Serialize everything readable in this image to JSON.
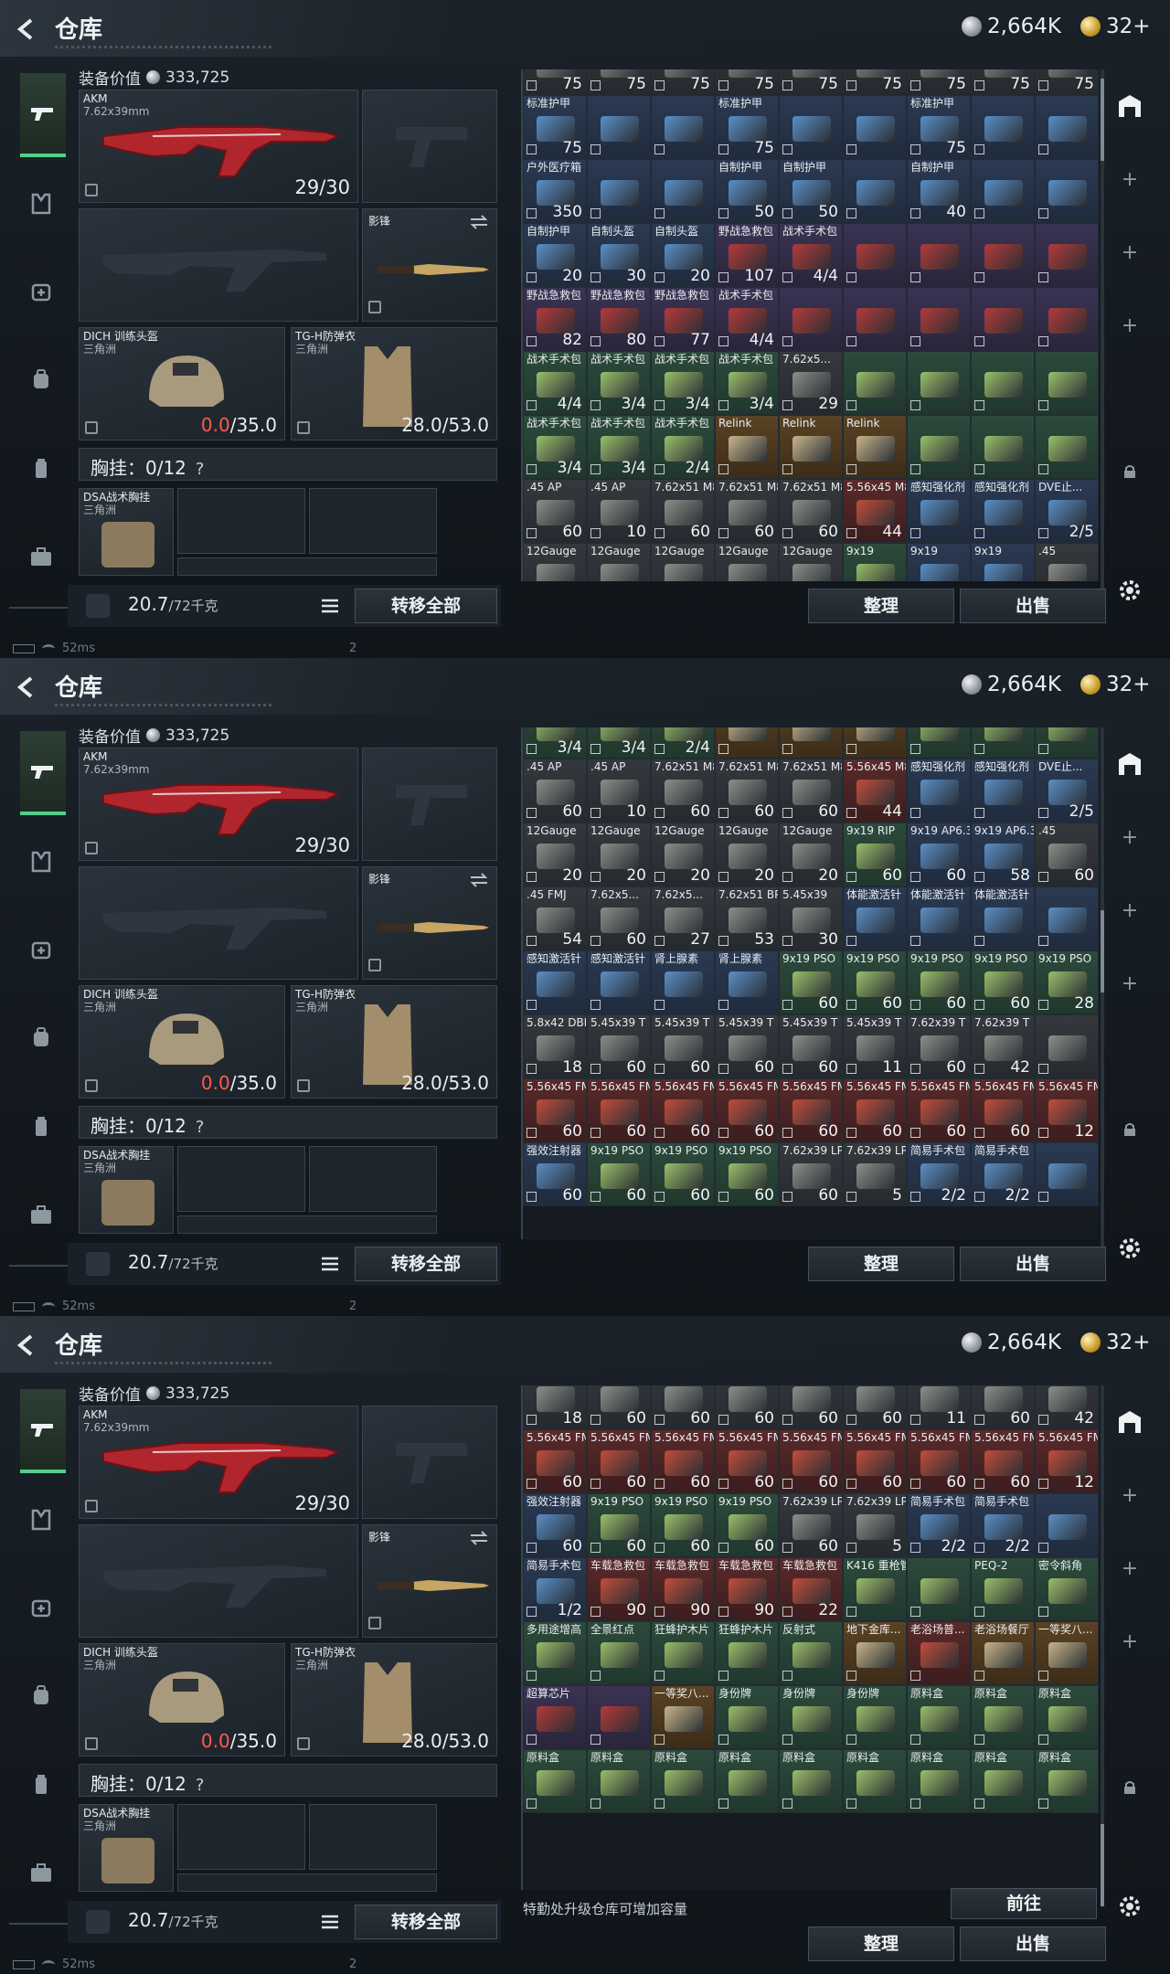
{
  "app": {
    "title": "仓库",
    "currency_silver": "2,664K",
    "currency_gold": "32+"
  },
  "loadout": {
    "value_label": "装备价值",
    "value": "333,725",
    "primary": {
      "name": "AKM",
      "caliber": "7.62x39mm",
      "ammo": "29/30"
    },
    "melee": {
      "name": "影锋"
    },
    "helmet": {
      "name": "DICH 训练头盔",
      "origin": "三角洲",
      "durability_cur": "0.0",
      "durability_max": "/35.0"
    },
    "armor": {
      "name": "TG-H防弹衣",
      "origin": "三角洲",
      "durability": "28.0/53.0"
    },
    "rig": {
      "label": "胸挂：0/12",
      "help": "?"
    },
    "rig_item": {
      "name": "DSA战术胸挂",
      "origin": "三角洲"
    },
    "weight": "20.7",
    "weight_max": "/72千克",
    "transfer_all": "转移全部"
  },
  "actions": {
    "sort": "整理",
    "sell": "出售",
    "goto": "前往",
    "upgrade_hint": "特勤处升级仓库可增加容量"
  },
  "status": {
    "ping": "52ms",
    "num": "2"
  },
  "panel1_rows": [
    [
      [
        "",
        "75",
        "gray"
      ],
      [
        "",
        "75",
        "gray"
      ],
      [
        "",
        "75",
        "gray"
      ],
      [
        "",
        "75",
        "gray"
      ],
      [
        "",
        "75",
        "gray"
      ],
      [
        "",
        "75",
        "gray"
      ],
      [
        "",
        "75",
        "gray"
      ],
      [
        "",
        "75",
        "gray"
      ],
      [
        "",
        "75",
        "gray"
      ]
    ],
    [
      [
        "标准护甲",
        "75",
        "blue"
      ],
      [
        "",
        "",
        "blue"
      ],
      [
        "",
        "",
        "blue"
      ],
      [
        "标准护甲",
        "75",
        "blue"
      ],
      [
        "",
        "",
        "blue"
      ],
      [
        "",
        "",
        "blue"
      ],
      [
        "标准护甲",
        "75",
        "blue"
      ],
      [
        "",
        "",
        "blue"
      ],
      [
        "",
        "",
        "blue"
      ]
    ],
    [
      [
        "户外医疗箱",
        "350",
        "blue"
      ],
      [
        "",
        "",
        "blue"
      ],
      [
        "",
        "",
        "blue"
      ],
      [
        "自制护甲",
        "50",
        "blue"
      ],
      [
        "自制护甲",
        "50",
        "blue"
      ],
      [
        "",
        "",
        "blue"
      ],
      [
        "自制护甲",
        "40",
        "blue"
      ],
      [
        "",
        "",
        "blue"
      ],
      [
        "",
        "",
        " blue"
      ]
    ],
    [
      [
        "自制护甲",
        "20",
        "blue"
      ],
      [
        "自制头盔",
        "30",
        "blue"
      ],
      [
        "自制头盔",
        "20",
        "blue"
      ],
      [
        "野战急救包",
        "107",
        "purple"
      ],
      [
        "战术手术包",
        "4/4",
        "purple"
      ],
      [
        "",
        "",
        "purple"
      ],
      [
        "",
        "",
        "purple"
      ],
      [
        "",
        "",
        "purple"
      ],
      [
        "",
        "",
        "purple"
      ]
    ],
    [
      [
        "野战急救包",
        "82",
        "purple"
      ],
      [
        "野战急救包",
        "80",
        "purple"
      ],
      [
        "野战急救包",
        "77",
        "purple"
      ],
      [
        "战术手术包",
        "4/4",
        "purple"
      ],
      [
        "",
        "",
        "purple"
      ],
      [
        "",
        "",
        "purple"
      ],
      [
        "",
        "",
        "purple"
      ],
      [
        "",
        "",
        "purple"
      ],
      [
        "",
        "",
        "purple"
      ]
    ],
    [
      [
        "战术手术包",
        "4/4",
        "green"
      ],
      [
        "战术手术包",
        "3/4",
        "green"
      ],
      [
        "战术手术包",
        "3/4",
        "green"
      ],
      [
        "战术手术包",
        "3/4",
        "green"
      ],
      [
        "7.62x5...",
        "29",
        "gray"
      ],
      [
        "",
        "",
        "green"
      ],
      [
        "",
        "",
        "green"
      ],
      [
        "",
        "",
        "green"
      ],
      [
        "",
        "",
        "green"
      ]
    ],
    [
      [
        "战术手术包",
        "3/4",
        "green"
      ],
      [
        "战术手术包",
        "3/4",
        "green"
      ],
      [
        "战术手术包",
        "2/4",
        "green"
      ],
      [
        "Relink",
        "",
        "gold"
      ],
      [
        "Relink",
        "",
        "gold"
      ],
      [
        "Relink",
        "",
        "gold"
      ],
      [
        "",
        "",
        "green"
      ],
      [
        "",
        "",
        "green"
      ],
      [
        "",
        "",
        "green"
      ]
    ],
    [
      [
        ".45 AP",
        "60",
        "gray"
      ],
      [
        ".45 AP",
        "10",
        "gray"
      ],
      [
        "7.62x51 M80",
        "60",
        "gray"
      ],
      [
        "7.62x51 M80",
        "60",
        "gray"
      ],
      [
        "7.62x51 M80",
        "60",
        "gray"
      ],
      [
        "5.56x45 M855A1",
        "44",
        "red"
      ],
      [
        "感知强化剂",
        "",
        "blue"
      ],
      [
        "感知强化剂",
        "",
        "blue"
      ],
      [
        "DVE止...",
        "2/5",
        "blue"
      ]
    ],
    [
      [
        "12Gauge",
        "",
        "gray"
      ],
      [
        "12Gauge",
        "",
        "gray"
      ],
      [
        "12Gauge",
        "",
        "gray"
      ],
      [
        "12Gauge",
        "",
        "gray"
      ],
      [
        "12Gauge",
        "",
        "gray"
      ],
      [
        "9x19",
        "",
        "green"
      ],
      [
        "9x19",
        "",
        "blue"
      ],
      [
        "9x19",
        "",
        "blue"
      ],
      [
        ".45",
        "",
        "gray"
      ]
    ]
  ],
  "panel2_rows": [
    [
      [
        "",
        "3/4",
        "green"
      ],
      [
        "",
        "3/4",
        "green"
      ],
      [
        "",
        "2/4",
        "green"
      ],
      [
        "",
        "",
        "gold"
      ],
      [
        "",
        "",
        "gold"
      ],
      [
        "",
        "",
        "gold"
      ],
      [
        "",
        "",
        "green"
      ],
      [
        "",
        "",
        "green"
      ],
      [
        "",
        "",
        "green"
      ]
    ],
    [
      [
        ".45 AP",
        "60",
        "gray"
      ],
      [
        ".45 AP",
        "10",
        "gray"
      ],
      [
        "7.62x51 M80",
        "60",
        "gray"
      ],
      [
        "7.62x51 M80",
        "60",
        "gray"
      ],
      [
        "7.62x51 M80",
        "60",
        "gray"
      ],
      [
        "5.56x45 M855A1",
        "44",
        "red"
      ],
      [
        "感知强化剂",
        "",
        "blue"
      ],
      [
        "感知强化剂",
        "",
        "blue"
      ],
      [
        "DVE止...",
        "2/5",
        "blue"
      ]
    ],
    [
      [
        "12Gauge",
        "20",
        "gray"
      ],
      [
        "12Gauge",
        "20",
        "gray"
      ],
      [
        "12Gauge",
        "20",
        "gray"
      ],
      [
        "12Gauge",
        "20",
        "gray"
      ],
      [
        "12Gauge",
        "20",
        "gray"
      ],
      [
        "9x19 RIP",
        "60",
        "green"
      ],
      [
        "9x19 AP6.3",
        "60",
        "blue"
      ],
      [
        "9x19 AP6.3",
        "58",
        "blue"
      ],
      [
        ".45",
        "60",
        "gray"
      ]
    ],
    [
      [
        ".45 FMJ",
        "54",
        "gray"
      ],
      [
        "7.62x5...",
        "60",
        "gray"
      ],
      [
        "7.62x5...",
        "27",
        "gray"
      ],
      [
        "7.62x51 BPZ",
        "53",
        "gray"
      ],
      [
        "5.45x39",
        "30",
        "gray"
      ],
      [
        "体能激活针",
        "",
        "blue"
      ],
      [
        "体能激活针",
        "",
        "blue"
      ],
      [
        "体能激活针",
        "",
        "blue"
      ],
      [
        "",
        "",
        "blue"
      ]
    ],
    [
      [
        "感知激活针",
        "",
        "blue"
      ],
      [
        "感知激活针",
        "",
        "blue"
      ],
      [
        "肾上腺素",
        "",
        "blue"
      ],
      [
        "肾上腺素",
        "",
        "blue"
      ],
      [
        "9x19 PSO",
        "60",
        "green"
      ],
      [
        "9x19 PSO",
        "60",
        "green"
      ],
      [
        "9x19 PSO",
        "60",
        "green"
      ],
      [
        "9x19 PSO",
        "60",
        "green"
      ],
      [
        "9x19 PSO",
        "28",
        "green"
      ]
    ],
    [
      [
        "5.8x42 DBP87",
        "18",
        "gray"
      ],
      [
        "5.45x39 T",
        "60",
        "gray"
      ],
      [
        "5.45x39 T",
        "60",
        "gray"
      ],
      [
        "5.45x39 T",
        "60",
        "gray"
      ],
      [
        "5.45x39 T",
        "60",
        "gray"
      ],
      [
        "5.45x39 T",
        "11",
        "gray"
      ],
      [
        "7.62x39 T",
        "60",
        "gray"
      ],
      [
        "7.62x39 T",
        "42",
        "gray"
      ],
      [
        "",
        "",
        "gray"
      ]
    ],
    [
      [
        "5.56x45 FMJ",
        "60",
        "red"
      ],
      [
        "5.56x45 FMJ",
        "60",
        "red"
      ],
      [
        "5.56x45 FMJ",
        "60",
        "red"
      ],
      [
        "5.56x45 FMJ",
        "60",
        "red"
      ],
      [
        "5.56x45 FMJ",
        "60",
        "red"
      ],
      [
        "5.56x45 FMJ",
        "60",
        "red"
      ],
      [
        "5.56x45 FMJ",
        "60",
        "red"
      ],
      [
        "5.56x45 FMJ",
        "60",
        "red"
      ],
      [
        "5.56x45 FMJ",
        "12",
        "red"
      ]
    ],
    [
      [
        "强效注射器",
        "60",
        "blue"
      ],
      [
        "9x19 PSO",
        "60",
        "green"
      ],
      [
        "9x19 PSO",
        "60",
        "green"
      ],
      [
        "9x19 PSO",
        "60",
        "green"
      ],
      [
        "7.62x39 LP",
        "60",
        "gray"
      ],
      [
        "7.62x39 LP",
        "5",
        "gray"
      ],
      [
        "简易手术包",
        "2/2",
        "blue"
      ],
      [
        "简易手术包",
        "2/2",
        "blue"
      ],
      [
        "",
        "",
        "blue"
      ]
    ]
  ],
  "panel3_rows": [
    [
      [
        "",
        "18",
        "gray"
      ],
      [
        "",
        "60",
        "gray"
      ],
      [
        "",
        "60",
        "gray"
      ],
      [
        "",
        "60",
        "gray"
      ],
      [
        "",
        "60",
        "gray"
      ],
      [
        "",
        "60",
        "gray"
      ],
      [
        "",
        "11",
        "gray"
      ],
      [
        "",
        "60",
        "gray"
      ],
      [
        "",
        "42",
        "gray"
      ]
    ],
    [
      [
        "5.56x45 FMJ",
        "60",
        "red"
      ],
      [
        "5.56x45 FMJ",
        "60",
        "red"
      ],
      [
        "5.56x45 FMJ",
        "60",
        "red"
      ],
      [
        "5.56x45 FMJ",
        "60",
        "red"
      ],
      [
        "5.56x45 FMJ",
        "60",
        "red"
      ],
      [
        "5.56x45 FMJ",
        "60",
        "red"
      ],
      [
        "5.56x45 FMJ",
        "60",
        "red"
      ],
      [
        "5.56x45 FMJ",
        "60",
        "red"
      ],
      [
        "5.56x45 FMJ",
        "12",
        "red"
      ]
    ],
    [
      [
        "强效注射器",
        "60",
        "blue"
      ],
      [
        "9x19 PSO",
        "60",
        "green"
      ],
      [
        "9x19 PSO",
        "60",
        "green"
      ],
      [
        "9x19 PSO",
        "60",
        "green"
      ],
      [
        "7.62x39 LP",
        "60",
        "gray"
      ],
      [
        "7.62x39 LP",
        "5",
        "gray"
      ],
      [
        "简易手术包",
        "2/2",
        "blue"
      ],
      [
        "简易手术包",
        "2/2",
        "blue"
      ],
      [
        "",
        "",
        "blue"
      ]
    ],
    [
      [
        "简易手术包",
        "1/2",
        "blue"
      ],
      [
        "车载急救包",
        "90",
        "red"
      ],
      [
        "车载急救包",
        "90",
        "red"
      ],
      [
        "车载急救包",
        "90",
        "red"
      ],
      [
        "车载急救包",
        "22",
        "red"
      ],
      [
        "K416 重枪管",
        "",
        "green"
      ],
      [
        "",
        "",
        "green"
      ],
      [
        "PEQ-2",
        "",
        "green"
      ],
      [
        "密令斜角",
        "",
        "green"
      ]
    ],
    [
      [
        "多用途增高",
        "",
        "green"
      ],
      [
        "全景红点",
        "",
        "green"
      ],
      [
        "狂蜂护木片",
        "",
        "green"
      ],
      [
        "狂蜂护木片",
        "",
        "green"
      ],
      [
        "反射式",
        "",
        "green"
      ],
      [
        "地下金库...",
        "",
        "gold"
      ],
      [
        "老浴场普...",
        "",
        "red"
      ],
      [
        "老浴场餐厅",
        "",
        "gold"
      ],
      [
        "一等奖八...",
        "",
        "gold"
      ]
    ],
    [
      [
        "超算芯片",
        "",
        "purple"
      ],
      [
        "",
        "",
        "purple"
      ],
      [
        "一等奖八...",
        "",
        "gold"
      ],
      [
        "身份牌",
        "",
        "green"
      ],
      [
        "身份牌",
        "",
        "green"
      ],
      [
        "身份牌",
        "",
        "green"
      ],
      [
        "原料盒",
        "",
        "green"
      ],
      [
        "原料盒",
        "",
        "green"
      ],
      [
        "原料盒",
        "",
        "green"
      ]
    ],
    [
      [
        "原料盒",
        "",
        "green"
      ],
      [
        "原料盒",
        "",
        "green"
      ],
      [
        "原料盒",
        "",
        "green"
      ],
      [
        "原料盒",
        "",
        "green"
      ],
      [
        "原料盒",
        "",
        "green"
      ],
      [
        "原料盒",
        "",
        "green"
      ],
      [
        "原料盒",
        "",
        "green"
      ],
      [
        "原料盒",
        "",
        "green"
      ],
      [
        "原料盒",
        "",
        "green"
      ]
    ]
  ],
  "colors": {
    "accent": "#4fd08a",
    "bg": "#141a20"
  }
}
